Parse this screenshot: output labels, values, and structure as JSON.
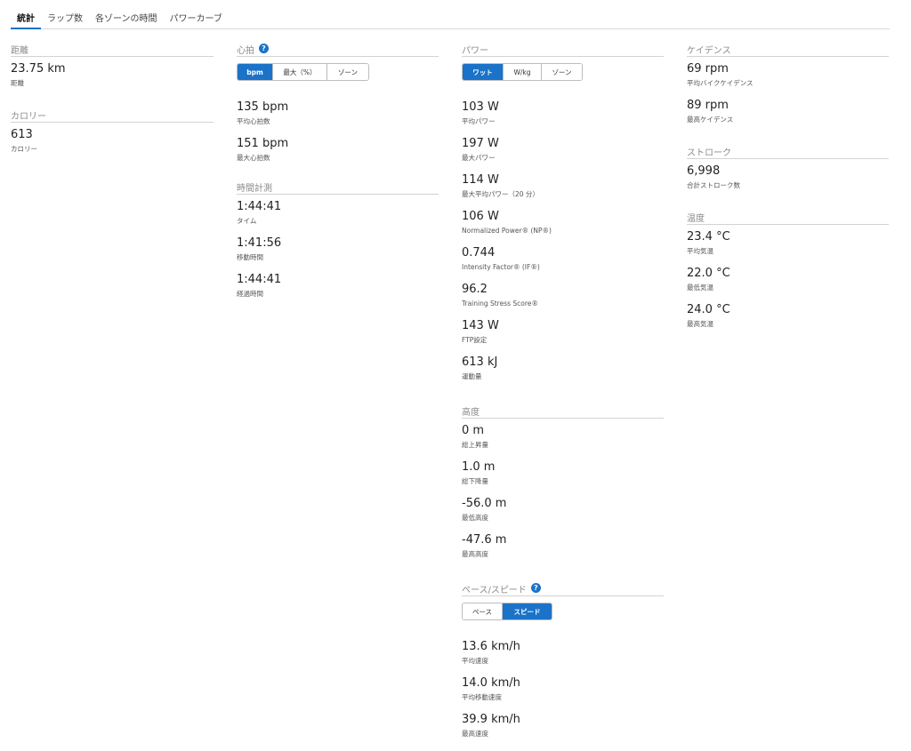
{
  "tabs": [
    "統計",
    "ラップ数",
    "各ゾーンの時間",
    "パワーカーブ"
  ],
  "distance": {
    "title": "距離",
    "value": "23.75 km",
    "label": "距離"
  },
  "calories": {
    "title": "カロリー",
    "value": "613",
    "label": "カロリー"
  },
  "heart_rate": {
    "title": "心拍",
    "toggle": [
      "bpm",
      "最大（%）",
      "ゾーン"
    ],
    "avg": {
      "value": "135 bpm",
      "label": "平均心拍数"
    },
    "max": {
      "value": "151 bpm",
      "label": "最大心拍数"
    }
  },
  "timing": {
    "title": "時間計測",
    "time": {
      "value": "1:44:41",
      "label": "タイム"
    },
    "moving": {
      "value": "1:41:56",
      "label": "移動時間"
    },
    "elapsed": {
      "value": "1:44:41",
      "label": "経過時間"
    }
  },
  "power": {
    "title": "パワー",
    "toggle": [
      "ワット",
      "W/kg",
      "ゾーン"
    ],
    "stats": [
      {
        "value": "103 W",
        "label": "平均パワー"
      },
      {
        "value": "197 W",
        "label": "最大パワー"
      },
      {
        "value": "114 W",
        "label": "最大平均パワー（20 分）"
      },
      {
        "value": "106 W",
        "label": "Normalized Power® (NP®)"
      },
      {
        "value": "0.744",
        "label": "Intensity Factor® (IF®)"
      },
      {
        "value": "96.2",
        "label": "Training Stress Score®"
      },
      {
        "value": "143 W",
        "label": "FTP設定"
      },
      {
        "value": "613 kJ",
        "label": "運動量"
      }
    ]
  },
  "elevation": {
    "title": "高度",
    "stats": [
      {
        "value": "0 m",
        "label": "総上昇量"
      },
      {
        "value": "1.0 m",
        "label": "総下降量"
      },
      {
        "value": "-56.0 m",
        "label": "最低高度"
      },
      {
        "value": "-47.6 m",
        "label": "最高高度"
      }
    ]
  },
  "pace_speed": {
    "title": "ペース/スピード",
    "toggle": [
      "ペース",
      "スピード"
    ],
    "stats": [
      {
        "value": "13.6 km/h",
        "label": "平均速度"
      },
      {
        "value": "14.0 km/h",
        "label": "平均移動速度"
      },
      {
        "value": "39.9 km/h",
        "label": "最高速度"
      }
    ]
  },
  "cadence": {
    "title": "ケイデンス",
    "avg": {
      "value": "69 rpm",
      "label": "平均バイクケイデンス"
    },
    "max": {
      "value": "89 rpm",
      "label": "最高ケイデンス"
    }
  },
  "stroke": {
    "title": "ストローク",
    "value": "6,998",
    "label": "合計ストローク数"
  },
  "temperature": {
    "title": "温度",
    "avg": {
      "value": "23.4 °C",
      "label": "平均気温"
    },
    "min": {
      "value": "22.0 °C",
      "label": "最低気温"
    },
    "max": {
      "value": "24.0 °C",
      "label": "最高気温"
    }
  },
  "colors": {
    "accent": "#1a73c8",
    "divider": "#d3d3d3",
    "section_title": "#8a8a8a"
  },
  "icons": {
    "help": "question-circle-icon"
  }
}
